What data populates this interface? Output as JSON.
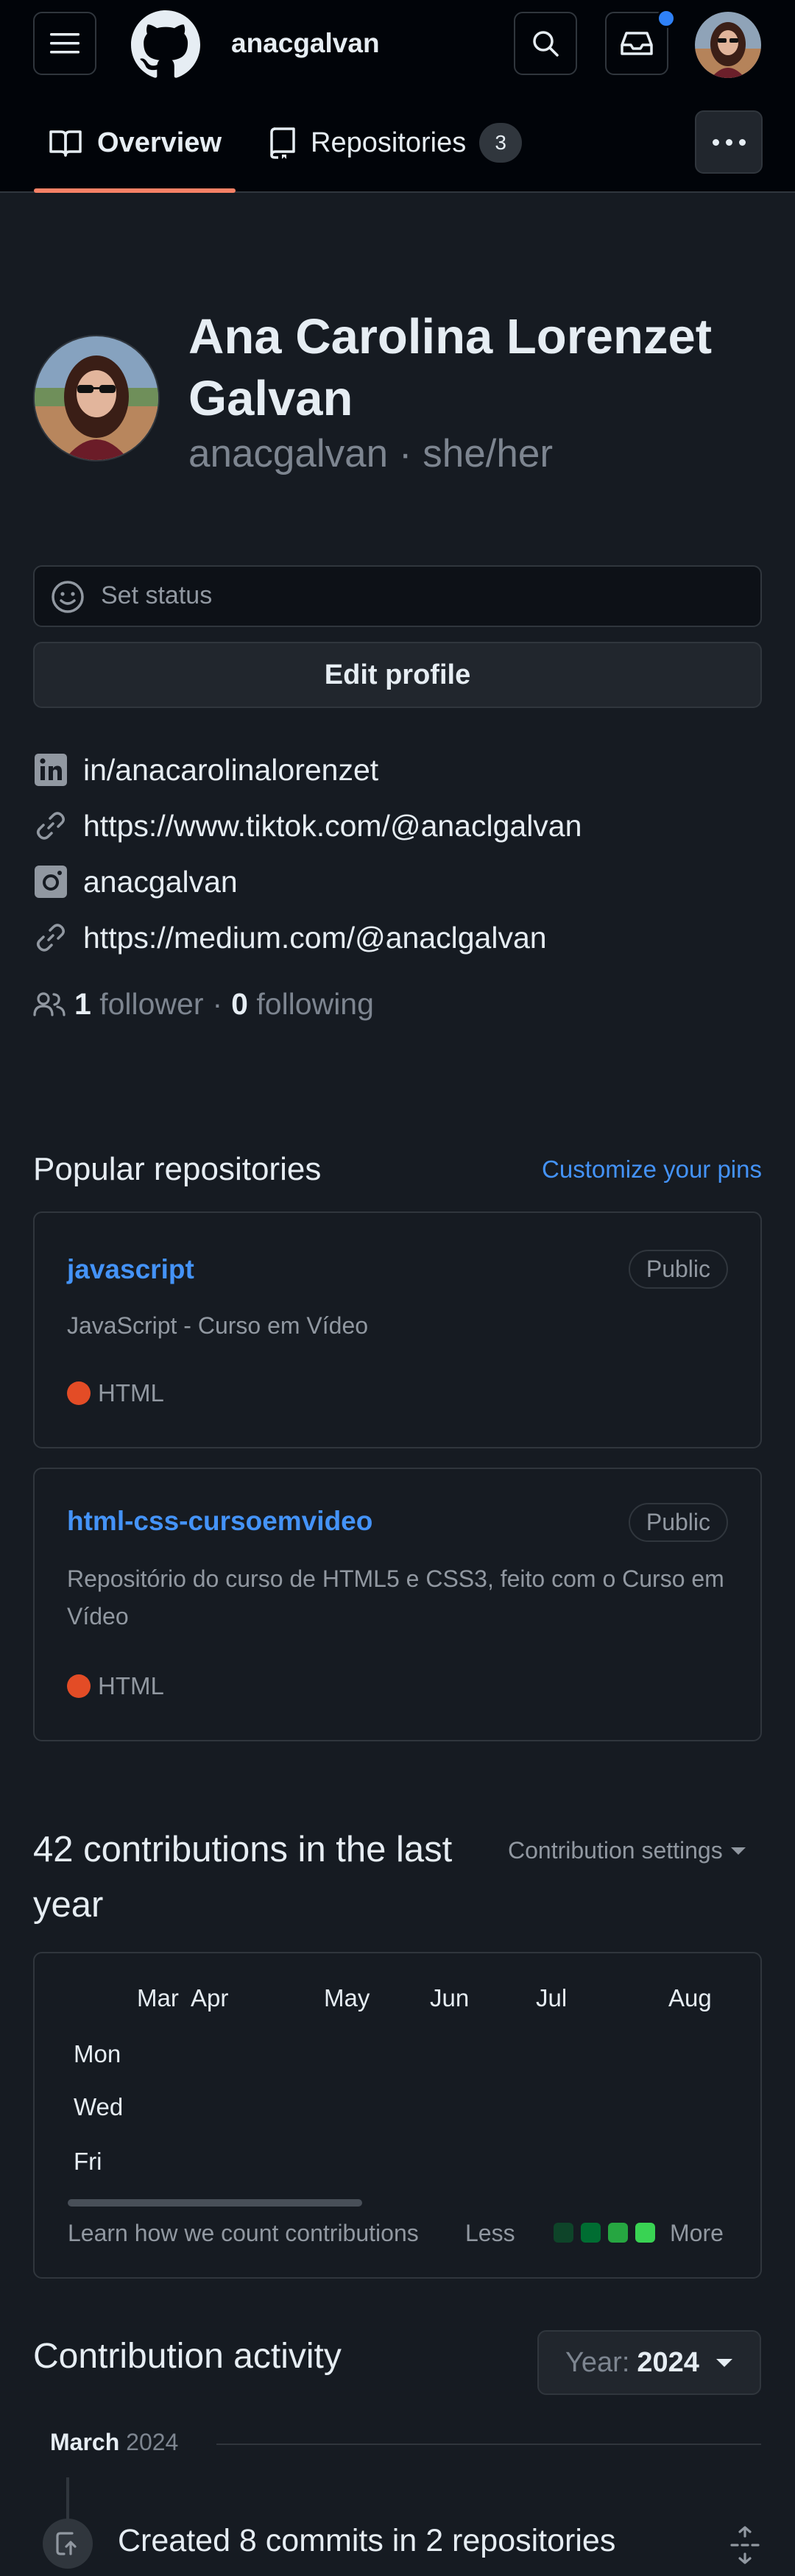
{
  "header": {
    "username": "anacgalvan",
    "icons": {
      "menu": "hamburger-menu-icon",
      "logo": "github-logo",
      "search": "search-icon",
      "inbox": "inbox-icon"
    }
  },
  "tabs": [
    {
      "label": "Overview",
      "icon": "book-icon",
      "selected": true
    },
    {
      "label": "Repositories",
      "icon": "repo-icon",
      "count": "3"
    }
  ],
  "profile": {
    "full_name_line1": "Ana Carolina Lorenzet",
    "full_name_line2": "Galvan",
    "login": "anacgalvan",
    "separator": "·",
    "pronouns": "she/her",
    "set_status": "Set status",
    "edit_profile": "Edit profile",
    "links": [
      {
        "icon": "linkedin-icon",
        "text": "in/anacarolinalorenzet"
      },
      {
        "icon": "link-icon",
        "text": "https://www.tiktok.com/@anaclgalvan"
      },
      {
        "icon": "instagram-icon",
        "text": "anacgalvan"
      },
      {
        "icon": "link-icon",
        "text": "https://medium.com/@anaclgalvan"
      }
    ],
    "followers_count": "1",
    "followers_label": "follower",
    "following_count": "0",
    "following_label": "following"
  },
  "popular": {
    "title": "Popular repositories",
    "customize": "Customize your pins",
    "repos": [
      {
        "name": "javascript",
        "visibility": "Public",
        "description": "JavaScript - Curso em Vídeo",
        "language": "HTML",
        "language_color": "#e34c26"
      },
      {
        "name": "html-css-cursoemvideo",
        "visibility": "Public",
        "description": "Repositório do curso de HTML5 e CSS3, feito com o Curso em Vídeo",
        "language": "HTML",
        "language_color": "#e34c26"
      }
    ]
  },
  "contributions": {
    "title_line1": "42 contributions in the last",
    "title_line2": "year",
    "settings": "Contribution settings",
    "months": [
      "Mar",
      "Apr",
      "May",
      "Jun",
      "Jul",
      "Aug"
    ],
    "days": [
      "Mon",
      "Wed",
      "Fri"
    ],
    "learn": "Learn how we count contributions",
    "less": "Less",
    "more": "More",
    "legend_colors": [
      "#0e4429",
      "#006d32",
      "#26a641",
      "#39d353"
    ]
  },
  "activity": {
    "title": "Contribution activity",
    "year_label": "Year:",
    "year_value": "2024",
    "period_month": "March",
    "period_year": "2024",
    "event": "Created 8 commits in 2 repositories"
  },
  "colors": {
    "accent_link": "#4493f8",
    "tab_underline": "#f78166",
    "background": "#0d1117"
  }
}
